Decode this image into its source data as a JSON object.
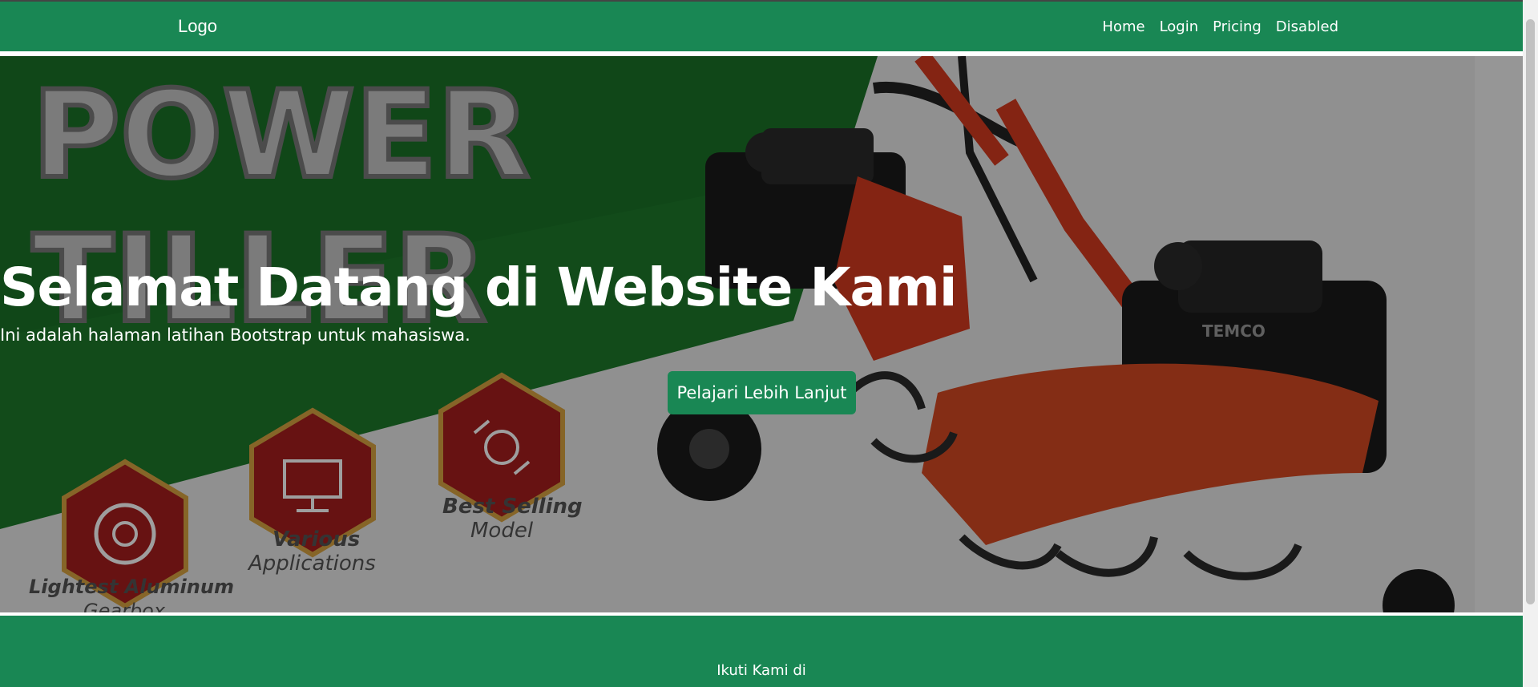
{
  "navbar": {
    "logo": "Logo",
    "links": [
      "Home",
      "Login",
      "Pricing",
      "Disabled"
    ]
  },
  "hero": {
    "image_text_line1": "POWER",
    "image_text_line2": "TILLER",
    "features": [
      {
        "label1": "Lightest Aluminum",
        "label2": "Gearbox"
      },
      {
        "label1": "Various",
        "label2": "Applications"
      },
      {
        "label1": "Best Selling",
        "label2": "Model"
      }
    ],
    "brand": "TEMCO",
    "title": "Selamat Datang di Website Kami",
    "subtitle": "Ini adalah halaman latihan Bootstrap untuk mahasiswa.",
    "button_label": "Pelajari Lebih Lanjut"
  },
  "footer": {
    "text": "Ikuti Kami di"
  },
  "colors": {
    "primary": "#198754",
    "hex_red": "#b3121b"
  }
}
